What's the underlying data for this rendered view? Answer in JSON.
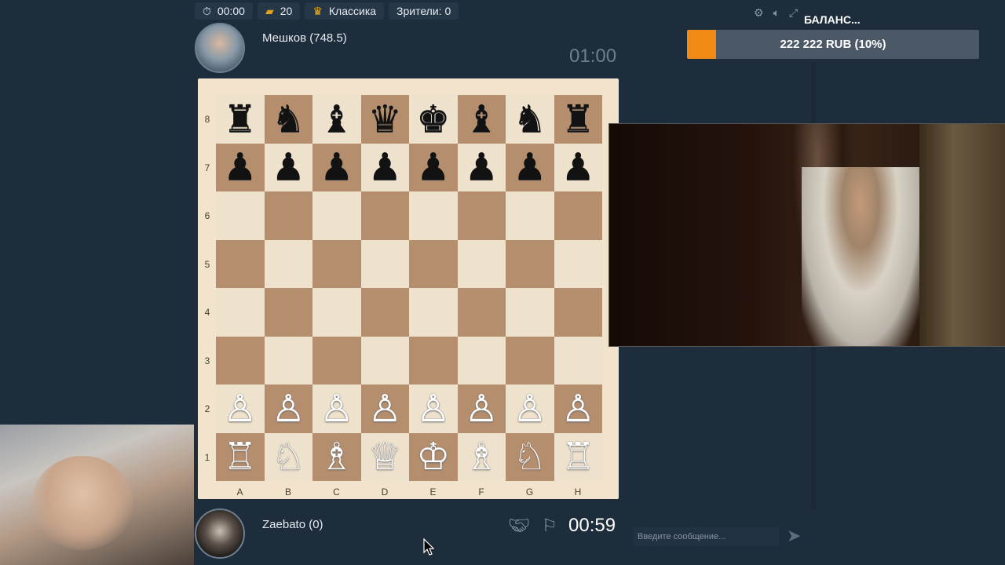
{
  "topbar": {
    "timer": "00:00",
    "gold": "20",
    "mode": "Классика",
    "viewers": "Зрители: 0"
  },
  "opponent": {
    "name": "Мешков (748.5)",
    "time": "01:00"
  },
  "player": {
    "name": "Zaebato (0)",
    "time": "00:59"
  },
  "board": {
    "ranks": [
      "8",
      "7",
      "6",
      "5",
      "4",
      "3",
      "2",
      "1"
    ],
    "files": [
      "A",
      "B",
      "C",
      "D",
      "E",
      "F",
      "G",
      "H"
    ],
    "rows": [
      [
        "♜",
        "♞",
        "♝",
        "♛",
        "♚",
        "♝",
        "♞",
        "♜"
      ],
      [
        "♟",
        "♟",
        "♟",
        "♟",
        "♟",
        "♟",
        "♟",
        "♟"
      ],
      [
        "",
        "",
        "",
        "",
        "",
        "",
        "",
        ""
      ],
      [
        "",
        "",
        "",
        "",
        "",
        "",
        "",
        ""
      ],
      [
        "",
        "",
        "",
        "",
        "",
        "",
        "",
        ""
      ],
      [
        "",
        "",
        "",
        "",
        "",
        "",
        "",
        ""
      ],
      [
        "♙",
        "♙",
        "♙",
        "♙",
        "♙",
        "♙",
        "♙",
        "♙"
      ],
      [
        "♖",
        "♘",
        "♗",
        "♕",
        "♔",
        "♗",
        "♘",
        "♖"
      ]
    ]
  },
  "balance": {
    "title": "БАЛАНС...",
    "amount": "222 222 RUB (10%)",
    "progress_fraction": 0.1
  },
  "chat": {
    "placeholder": "Введите сообщение..."
  },
  "colors": {
    "accent": "#ef8a17",
    "background": "#1e2d3c",
    "dark_square": "#b58e6e",
    "light_square": "#efe2cd"
  },
  "icons": [
    "stopwatch-icon",
    "gold-bars-icon",
    "crown-icon",
    "settings-icon",
    "volume-icon",
    "fullscreen-icon",
    "handshake-icon",
    "flag-icon",
    "send-icon"
  ]
}
